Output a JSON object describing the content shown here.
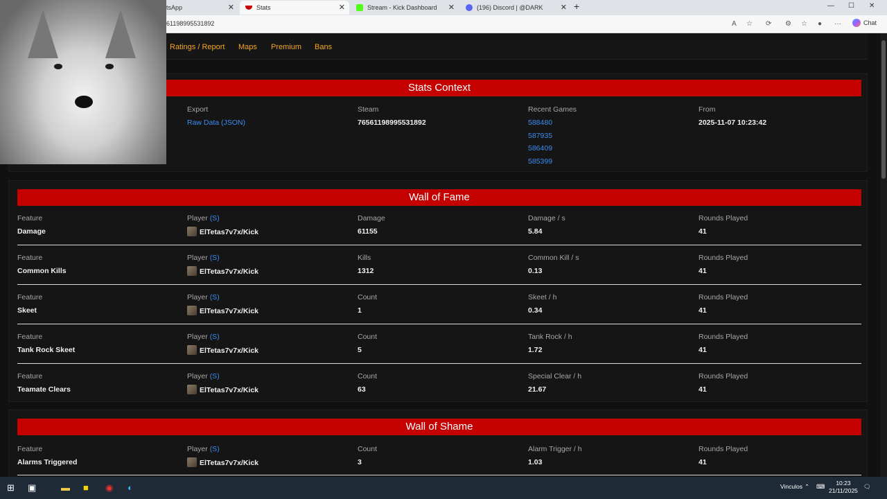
{
  "browser": {
    "tabs": [
      {
        "title": "tsApp",
        "active": false
      },
      {
        "title": "Stats",
        "active": true
      },
      {
        "title": "Stream - Kick Dashboard",
        "active": false
      },
      {
        "title": "(196) Discord | @DARK",
        "active": false
      }
    ],
    "url": "61198995531892",
    "chat_label": "Chat"
  },
  "nav": {
    "items": [
      "Ratings / Report",
      "Maps",
      "Premium",
      "Bans"
    ]
  },
  "stats_context": {
    "title": "Stats Context",
    "export_label": "Export",
    "export_link": "Raw Data (JSON)",
    "steam_label": "Steam",
    "steam_id": "76561198995531892",
    "recent_label": "Recent Games",
    "recent_games": [
      "588480",
      "587935",
      "586409",
      "585399"
    ],
    "from_label": "From",
    "from_value": "2025-11-07 10:23:42"
  },
  "wall_of_fame": {
    "title": "Wall of Fame",
    "rows": [
      {
        "feature_label": "Feature",
        "feature": "Damage",
        "player_label": "Player",
        "s": "(S)",
        "player": "ElTetas7v7x/Kick",
        "c3_label": "Damage",
        "c3": "61155",
        "c4_label": "Damage / s",
        "c4": "5.84",
        "c5_label": "Rounds Played",
        "c5": "41"
      },
      {
        "feature_label": "Feature",
        "feature": "Common Kills",
        "player_label": "Player",
        "s": "(S)",
        "player": "ElTetas7v7x/Kick",
        "c3_label": "Kills",
        "c3": "1312",
        "c4_label": "Common Kill / s",
        "c4": "0.13",
        "c5_label": "Rounds Played",
        "c5": "41"
      },
      {
        "feature_label": "Feature",
        "feature": "Skeet",
        "player_label": "Player",
        "s": "(S)",
        "player": "ElTetas7v7x/Kick",
        "c3_label": "Count",
        "c3": "1",
        "c4_label": "Skeet / h",
        "c4": "0.34",
        "c5_label": "Rounds Played",
        "c5": "41"
      },
      {
        "feature_label": "Feature",
        "feature": "Tank Rock Skeet",
        "player_label": "Player",
        "s": "(S)",
        "player": "ElTetas7v7x/Kick",
        "c3_label": "Count",
        "c3": "5",
        "c4_label": "Tank Rock / h",
        "c4": "1.72",
        "c5_label": "Rounds Played",
        "c5": "41"
      },
      {
        "feature_label": "Feature",
        "feature": "Teamate Clears",
        "player_label": "Player",
        "s": "(S)",
        "player": "ElTetas7v7x/Kick",
        "c3_label": "Count",
        "c3": "63",
        "c4_label": "Special Clear / h",
        "c4": "21.67",
        "c5_label": "Rounds Played",
        "c5": "41"
      }
    ]
  },
  "wall_of_shame": {
    "title": "Wall of Shame",
    "rows": [
      {
        "feature_label": "Feature",
        "feature": "Alarms Triggered",
        "player_label": "Player",
        "s": "(S)",
        "player": "ElTetas7v7x/Kick",
        "c3_label": "Count",
        "c3": "3",
        "c4_label": "Alarm Trigger / h",
        "c4": "1.03",
        "c5_label": "Rounds Played",
        "c5": "41"
      }
    ]
  },
  "taskbar": {
    "tray_label": "Vinculos",
    "time": "10:23",
    "date": "21/11/2025"
  },
  "colors": {
    "accent_red": "#c40000",
    "nav_orange": "#f5a623",
    "link_blue": "#3b8df0"
  }
}
